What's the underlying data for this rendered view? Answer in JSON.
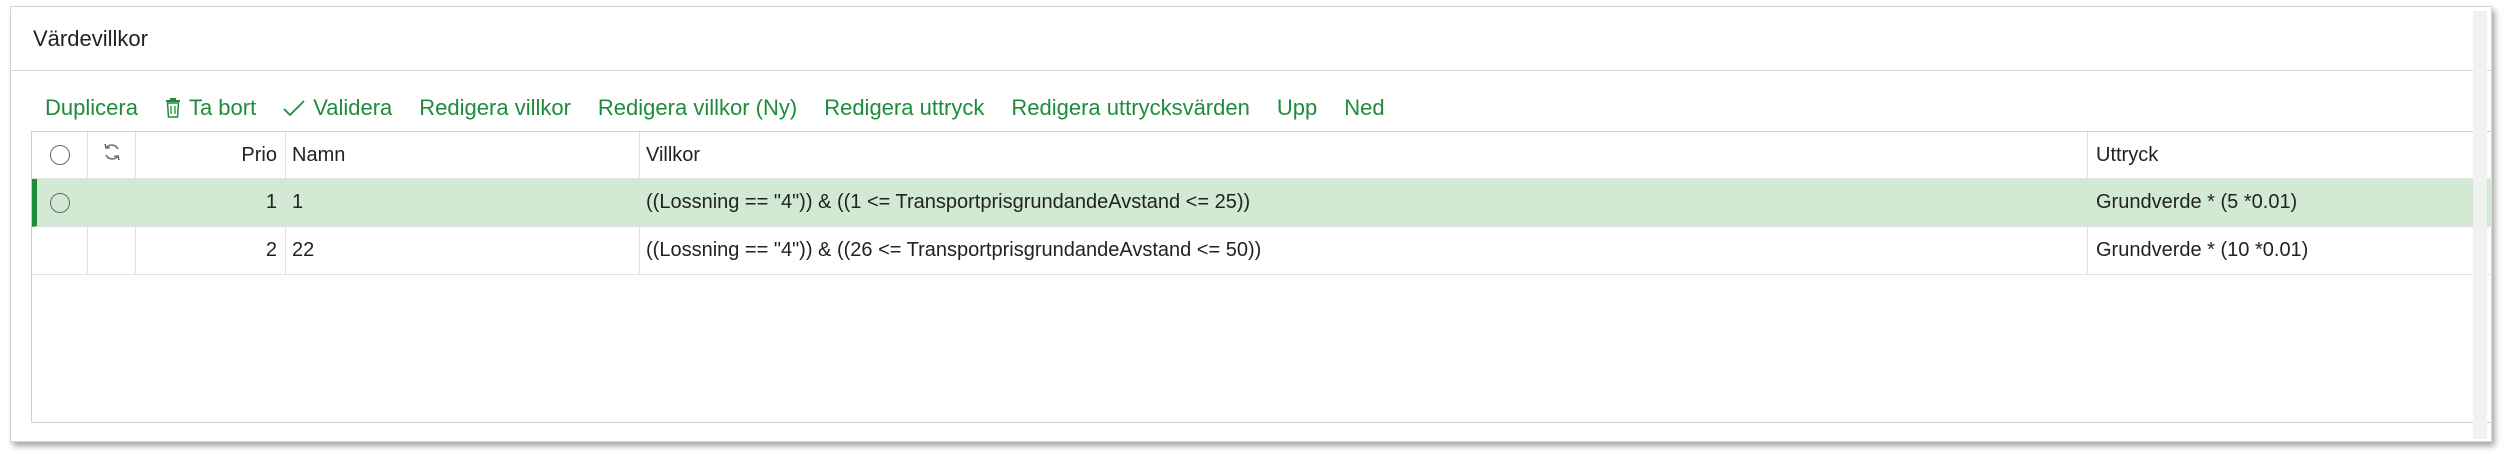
{
  "panel": {
    "title": "Värdevillkor"
  },
  "toolbar": {
    "duplicate": "Duplicera",
    "delete": "Ta bort",
    "validate": "Validera",
    "edit_condition": "Redigera villkor",
    "edit_condition_new": "Redigera villkor (Ny)",
    "edit_expression": "Redigera uttryck",
    "edit_expression_values": "Redigera uttrycksvärden",
    "up": "Upp",
    "down": "Ned",
    "accent_color": "#1e8c3a"
  },
  "table": {
    "columns": {
      "prio": "Prio",
      "namn": "Namn",
      "villkor": "Villkor",
      "uttryck": "Uttryck"
    },
    "rows": [
      {
        "prio": "1",
        "namn": "1",
        "villkor": "((Lossning == \"4\")) & ((1 <= TransportprisgrundandeAvstand <= 25))",
        "uttryck": "Grundverde * (5 *0.01)",
        "selected": true
      },
      {
        "prio": "2",
        "namn": "22",
        "villkor": "((Lossning == \"4\")) & ((26 <= TransportprisgrundandeAvstand <= 50))",
        "uttryck": "Grundverde * (10 *0.01)",
        "selected": false
      }
    ],
    "selected_row_color": "#d2e9d3"
  }
}
